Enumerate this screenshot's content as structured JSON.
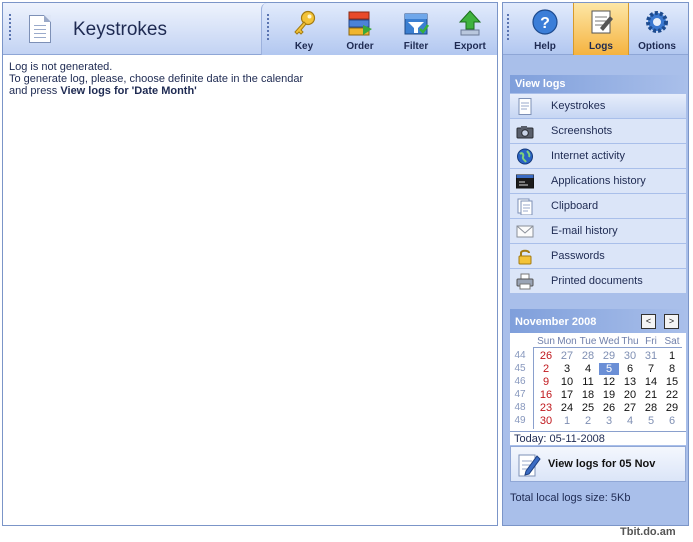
{
  "main": {
    "title": "Keystrokes",
    "toolbar": [
      {
        "label": "Key",
        "icon": "key-icon"
      },
      {
        "label": "Order",
        "icon": "order-icon"
      },
      {
        "label": "Filter",
        "icon": "filter-icon"
      },
      {
        "label": "Export",
        "icon": "export-icon"
      }
    ],
    "message": {
      "line1": "Log is not generated.",
      "line2": "To generate log, please, choose definite date in the calendar",
      "line3_prefix": "and press ",
      "line3_bold": "View logs for 'Date Month'"
    }
  },
  "side": {
    "toolbar": [
      {
        "label": "Help",
        "icon": "help-icon"
      },
      {
        "label": "Logs",
        "icon": "logs-icon",
        "active": true
      },
      {
        "label": "Options",
        "icon": "options-icon"
      }
    ],
    "view_logs_header": "View logs",
    "view_logs_items": [
      {
        "label": "Keystrokes",
        "icon": "document-icon",
        "selected": true
      },
      {
        "label": "Screenshots",
        "icon": "camera-icon"
      },
      {
        "label": "Internet activity",
        "icon": "globe-icon"
      },
      {
        "label": "Applications history",
        "icon": "application-window-icon"
      },
      {
        "label": "Clipboard",
        "icon": "clipboard-icon"
      },
      {
        "label": "E-mail history",
        "icon": "envelope-icon"
      },
      {
        "label": "Passwords",
        "icon": "padlock-icon"
      },
      {
        "label": "Printed documents",
        "icon": "printer-icon"
      }
    ],
    "calendar": {
      "month_title": "November 2008",
      "prev_label": "<",
      "next_label": ">",
      "weekdays": [
        "Sun",
        "Mon",
        "Tue",
        "Wed",
        "Thu",
        "Fri",
        "Sat"
      ],
      "weeks": [
        {
          "num": "44",
          "days": [
            "26",
            "27",
            "28",
            "29",
            "30",
            "31",
            "1"
          ]
        },
        {
          "num": "45",
          "days": [
            "2",
            "3",
            "4",
            "5",
            "6",
            "7",
            "8"
          ]
        },
        {
          "num": "46",
          "days": [
            "9",
            "10",
            "11",
            "12",
            "13",
            "14",
            "15"
          ]
        },
        {
          "num": "47",
          "days": [
            "16",
            "17",
            "18",
            "19",
            "20",
            "21",
            "22"
          ]
        },
        {
          "num": "48",
          "days": [
            "23",
            "24",
            "25",
            "26",
            "27",
            "28",
            "29"
          ]
        },
        {
          "num": "49",
          "days": [
            "30",
            "1",
            "2",
            "3",
            "4",
            "5",
            "6"
          ]
        }
      ],
      "today_cell": {
        "week": 1,
        "day": 3
      },
      "today_label": "Today: 05-11-2008"
    },
    "view_button_label": "View logs for 05 Nov",
    "total_size": "Total local logs size: 5Kb"
  },
  "watermark": "Tbit.do.am",
  "colors": {
    "accent": "#6b8fd6",
    "panel": "#a9bfea",
    "active_tab": "#f5b33f",
    "sunday": "#c0181d"
  }
}
